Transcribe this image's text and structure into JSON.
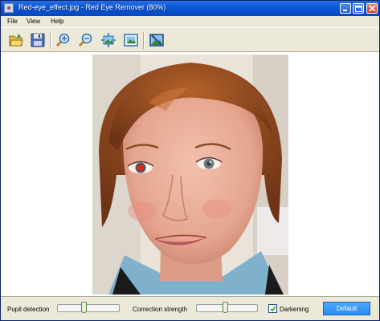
{
  "window": {
    "title": "Red-eye_effect.jpg - Red Eye Remover (80%)"
  },
  "menu": {
    "file": "File",
    "view": "View",
    "help": "Help"
  },
  "toolbar": {
    "icons": [
      "open-folder-icon",
      "save-disk-icon",
      "zoom-in-icon",
      "zoom-out-icon",
      "fit-to-window-icon",
      "actual-size-icon",
      "apply-correction-icon"
    ]
  },
  "image": {
    "description_free": true,
    "eyes": {
      "left": "red",
      "right": "gray"
    }
  },
  "controls": {
    "pupil_detection_label": "Pupil detection",
    "pupil_detection_value": 0.42,
    "correction_strength_label": "Correction strength",
    "correction_strength_value": 0.47,
    "darkening_label": "Darkening",
    "darkening_checked": true,
    "default_button": "Default"
  },
  "colors": {
    "title_bar": "#0a56d6",
    "default_button": "#2c8cf0",
    "chrome": "#ece9d8"
  }
}
